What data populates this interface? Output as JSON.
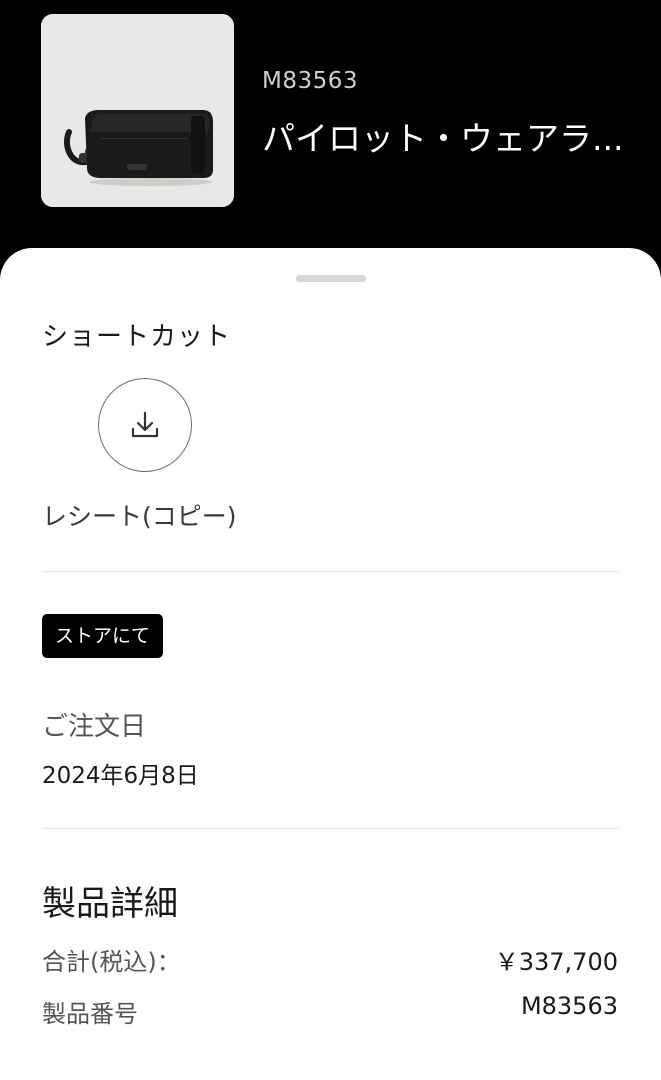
{
  "header": {
    "sku": "M83563",
    "product_name": "パイロット・ウェアラ..."
  },
  "shortcuts": {
    "title": "ショートカット",
    "receipt_label": "レシート(コピー)",
    "receipt_icon": "download-icon"
  },
  "order": {
    "badge": "ストアにて",
    "date_label": "ご注文日",
    "date_value": "2024年6月8日"
  },
  "details": {
    "title": "製品詳細",
    "total_label": "合計(税込)：",
    "total_value": "￥337,700",
    "number_label": "製品番号",
    "number_value": "M83563"
  }
}
